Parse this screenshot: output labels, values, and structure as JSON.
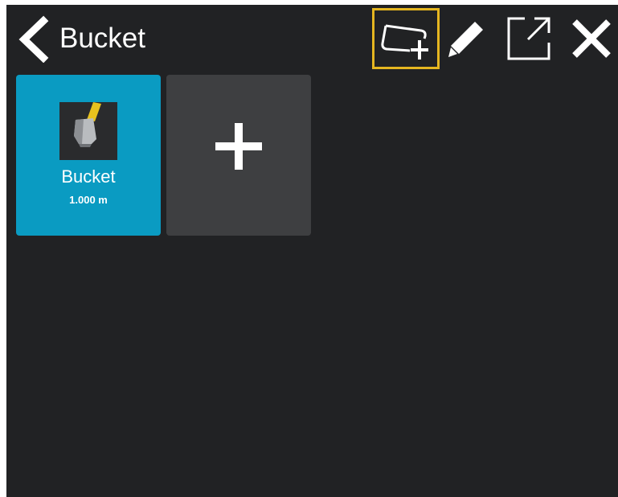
{
  "header": {
    "title": "Bucket",
    "tools": [
      {
        "icon": "add-outline-icon",
        "highlighted": true
      },
      {
        "icon": "pencil-icon"
      },
      {
        "icon": "export-icon"
      },
      {
        "icon": "close-icon"
      }
    ]
  },
  "tiles": [
    {
      "name": "Bucket",
      "size": "1.000 m",
      "icon": "bucket-thumbnail",
      "color": "#0a9bc2"
    },
    {
      "icon": "plus-icon",
      "color": "#3e3f41"
    }
  ],
  "colors": {
    "background": "#212224",
    "highlight": "#e5b620",
    "accent": "#0a9bc2"
  }
}
